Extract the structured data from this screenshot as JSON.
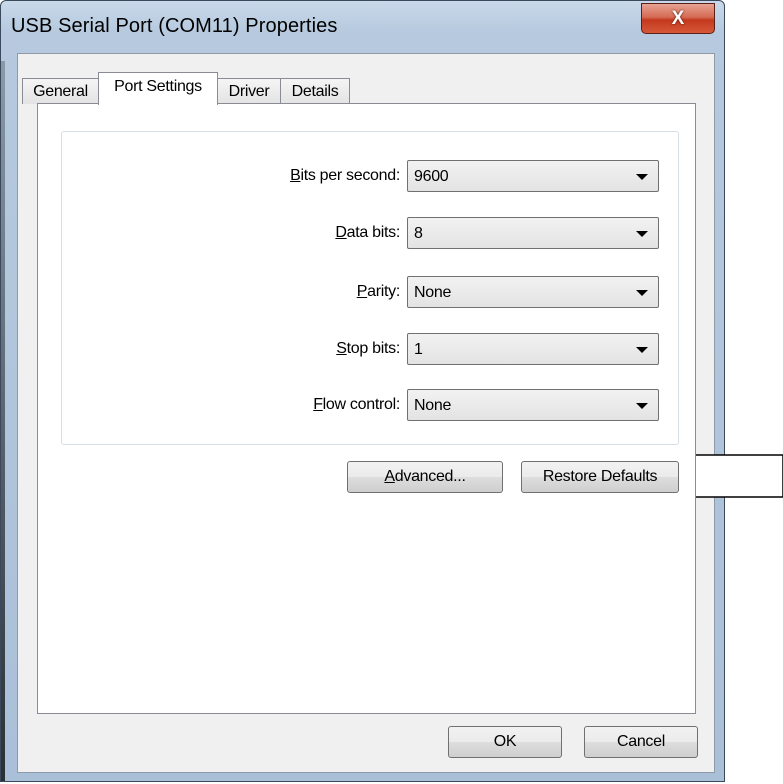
{
  "window": {
    "title": "USB Serial Port (COM11) Properties",
    "close_label": "X"
  },
  "tabs": [
    {
      "label": "General"
    },
    {
      "label": "Port Settings"
    },
    {
      "label": "Driver"
    },
    {
      "label": "Details"
    }
  ],
  "settings": [
    {
      "mnemonic": "B",
      "label_rest": "its per second:",
      "value": "9600"
    },
    {
      "mnemonic": "D",
      "label_rest": "ata bits:",
      "value": "8"
    },
    {
      "mnemonic": "P",
      "label_rest": "arity:",
      "value": "None"
    },
    {
      "mnemonic": "S",
      "label_rest": "top bits:",
      "value": "1"
    },
    {
      "mnemonic": "F",
      "label_rest": "low control:",
      "value": "None"
    }
  ],
  "buttons": {
    "advanced_mnemonic": "A",
    "advanced_rest": "dvanced...",
    "restore": "Restore Defaults",
    "ok": "OK",
    "cancel": "Cancel"
  }
}
